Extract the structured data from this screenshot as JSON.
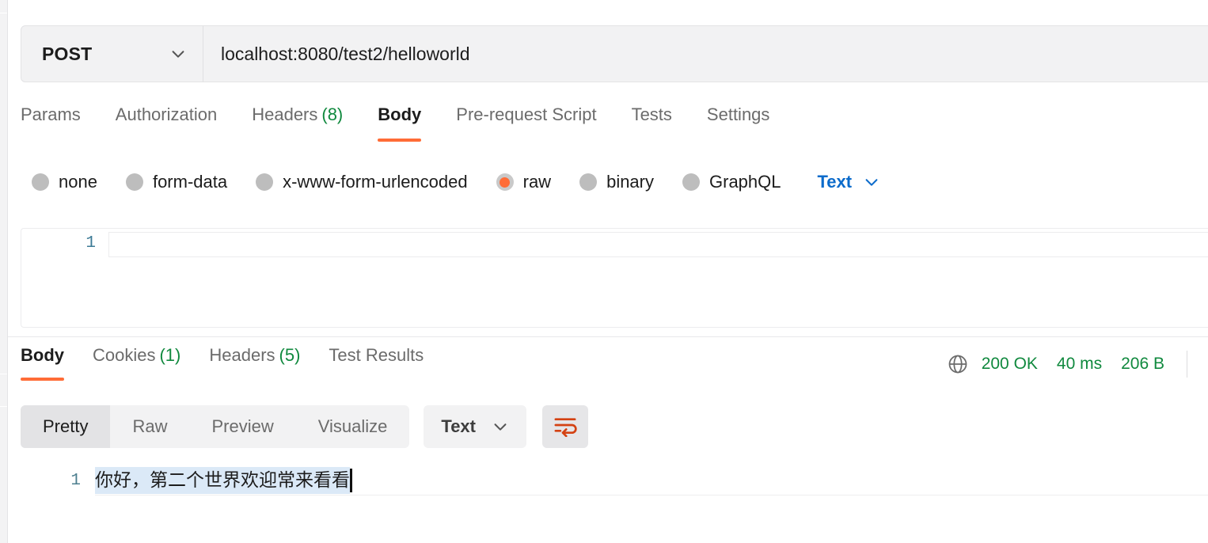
{
  "request": {
    "method": "POST",
    "url": "localhost:8080/test2/helloworld",
    "method_chevron_icon": "chevron-down-icon",
    "tabs": [
      {
        "label": "Params",
        "count": "",
        "active": false
      },
      {
        "label": "Authorization",
        "count": "",
        "active": false
      },
      {
        "label": "Headers",
        "count": "(8)",
        "active": false
      },
      {
        "label": "Body",
        "count": "",
        "active": true
      },
      {
        "label": "Pre-request Script",
        "count": "",
        "active": false
      },
      {
        "label": "Tests",
        "count": "",
        "active": false
      },
      {
        "label": "Settings",
        "count": "",
        "active": false
      }
    ],
    "body_types": [
      {
        "label": "none",
        "selected": false
      },
      {
        "label": "form-data",
        "selected": false
      },
      {
        "label": "x-www-form-urlencoded",
        "selected": false
      },
      {
        "label": "raw",
        "selected": true
      },
      {
        "label": "binary",
        "selected": false
      },
      {
        "label": "GraphQL",
        "selected": false
      }
    ],
    "raw_format": "Text",
    "raw_format_chevron_icon": "chevron-down-icon",
    "editor": {
      "line_number": "1",
      "content": ""
    }
  },
  "response": {
    "tabs": [
      {
        "label": "Body",
        "count": "",
        "active": true
      },
      {
        "label": "Cookies",
        "count": "(1)",
        "active": false
      },
      {
        "label": "Headers",
        "count": "(5)",
        "active": false
      },
      {
        "label": "Test Results",
        "count": "",
        "active": false
      }
    ],
    "meta": {
      "globe_icon": "globe-icon",
      "status": "200 OK",
      "time": "40 ms",
      "size": "206 B",
      "status_color": "#10893e"
    },
    "view_modes": [
      {
        "label": "Pretty",
        "active": true
      },
      {
        "label": "Raw",
        "active": false
      },
      {
        "label": "Preview",
        "active": false
      },
      {
        "label": "Visualize",
        "active": false
      }
    ],
    "format": "Text",
    "format_chevron_icon": "chevron-down-icon",
    "wrap_icon": "word-wrap-icon",
    "wrap_active": true,
    "body": {
      "line_number": "1",
      "text": "你好，第二个世界欢迎常来看看"
    }
  },
  "colors": {
    "accent": "#ff6c37",
    "success": "#10893e",
    "link": "#0b6bcb",
    "selection": "#dbe9f7"
  }
}
